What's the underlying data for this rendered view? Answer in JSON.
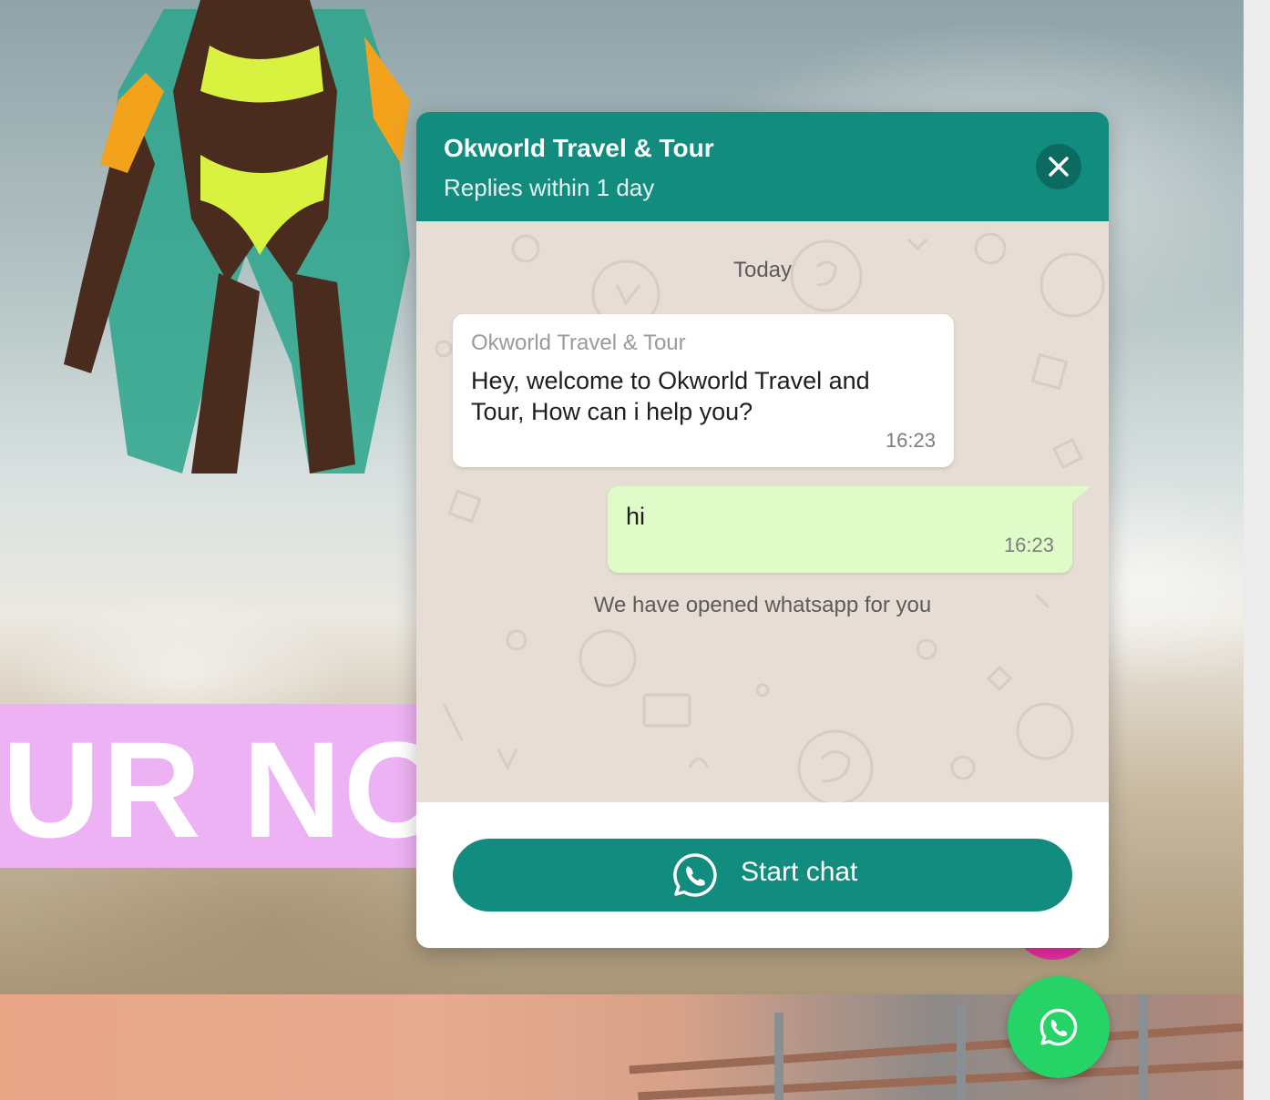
{
  "background": {
    "banner_text": "UR NO"
  },
  "chat_widget": {
    "header": {
      "title": "Okworld Travel & Tour",
      "subtitle": "Replies within 1 day"
    },
    "body": {
      "day_label": "Today",
      "messages": [
        {
          "direction": "incoming",
          "sender": "Okworld Travel & Tour",
          "text": "Hey, welcome to Okworld Travel and Tour, How can i help you?",
          "time": "16:23"
        },
        {
          "direction": "outgoing",
          "text": "hi",
          "time": "16:23"
        }
      ],
      "system_note": "We have opened whatsapp for you"
    },
    "footer": {
      "start_chat_label": "Start chat"
    }
  },
  "icons": {
    "close": "close-icon",
    "start_chat": "whatsapp-icon",
    "fab": "whatsapp-icon"
  },
  "colors": {
    "header": "#128c7e",
    "outgoing_bubble": "#dffcc8",
    "fab": "#25d366",
    "banner": "#edb2f3"
  }
}
